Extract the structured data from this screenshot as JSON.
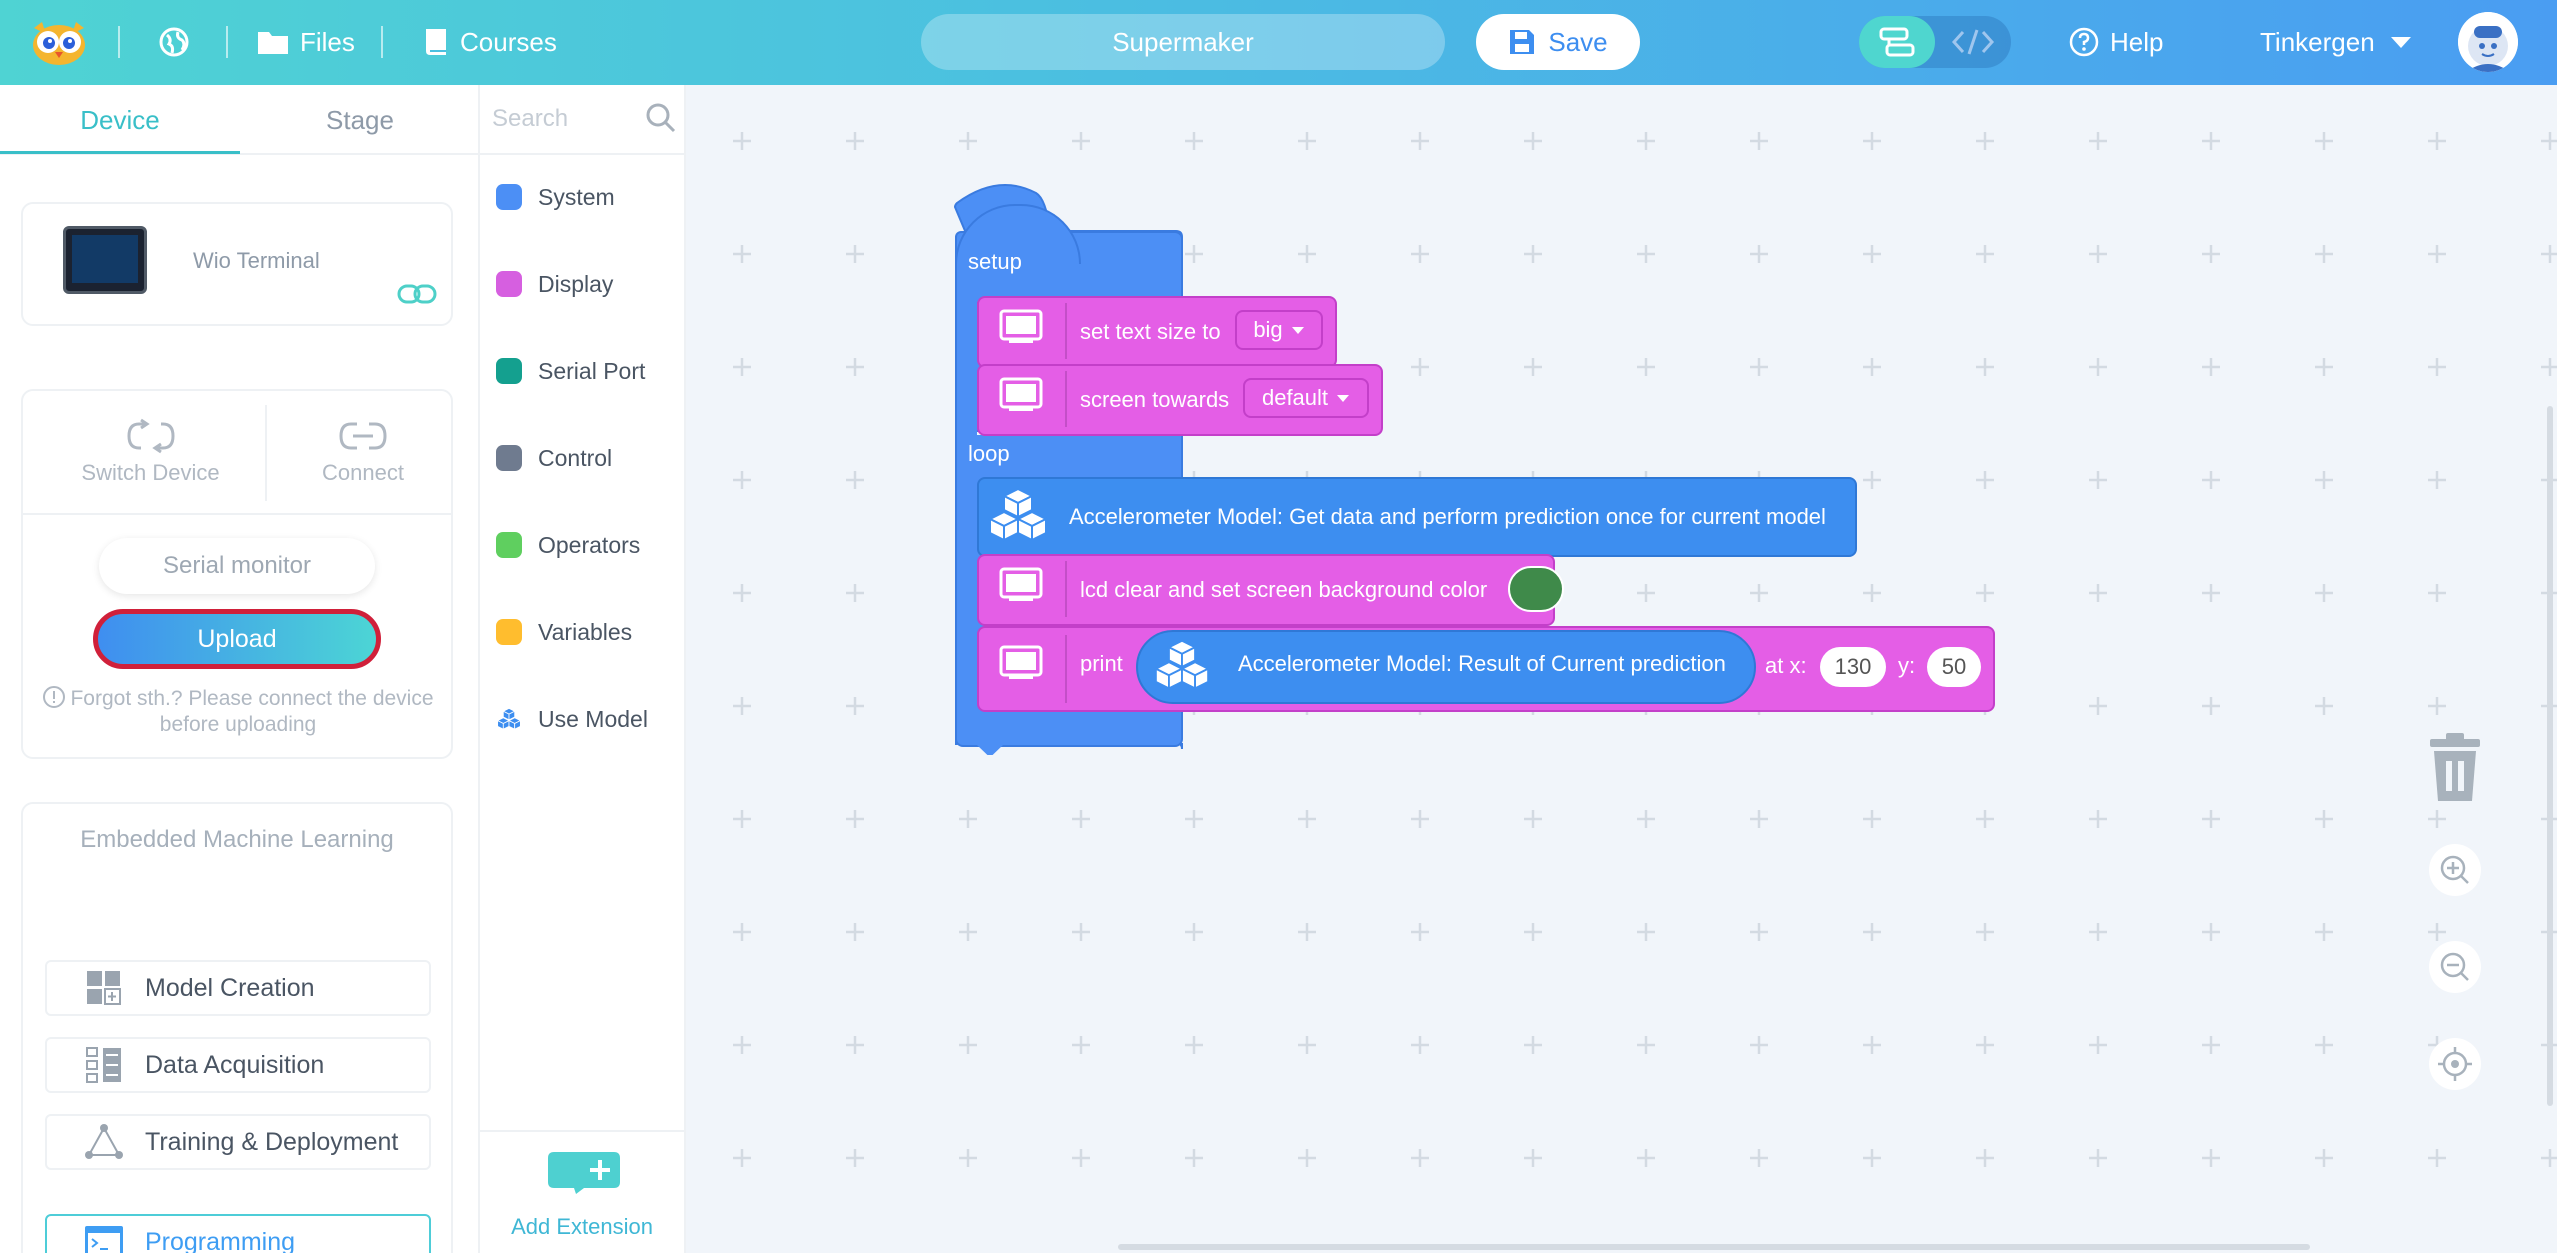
{
  "topbar": {
    "files": "Files",
    "courses": "Courses",
    "project_name": "Supermaker",
    "save": "Save",
    "help": "Help",
    "user": "Tinkergen"
  },
  "left_panel": {
    "tabs": [
      "Device",
      "Stage"
    ],
    "device_name": "Wio Terminal",
    "switch_device": "Switch Device",
    "connect": "Connect",
    "serial_monitor": "Serial monitor",
    "upload": "Upload",
    "upload_hint": "Forgot sth.? Please connect the device before uploading",
    "eml_title": "Embedded Machine Learning",
    "eml_items": [
      "Model Creation",
      "Data Acquisition",
      "Training & Deployment",
      "Programming"
    ]
  },
  "categories": {
    "search_placeholder": "Search",
    "items": [
      {
        "label": "System",
        "color": "#4c8ff5"
      },
      {
        "label": "Display",
        "color": "#d65fe0"
      },
      {
        "label": "Serial Port",
        "color": "#14a08f"
      },
      {
        "label": "Control",
        "color": "#6f7b8f"
      },
      {
        "label": "Operators",
        "color": "#5fcf5f"
      },
      {
        "label": "Variables",
        "color": "#ffbd2e"
      },
      {
        "label": "Use Model",
        "color": "#3d8ef0"
      }
    ],
    "add_extension": "Add Extension"
  },
  "blocks": {
    "setup": "setup",
    "set_text_size": "set text size to",
    "text_size_value": "big",
    "screen_towards": "screen towards",
    "screen_towards_value": "default",
    "loop": "loop",
    "accel_predict": "Accelerometer Model: Get data and perform prediction once for current model",
    "lcd_clear": "lcd clear and set screen background color",
    "lcd_color": "#3f8a4a",
    "print": "print",
    "accel_result": "Accelerometer Model: Result of Current prediction",
    "at_x": "at x:",
    "x_value": "130",
    "y_label": "y:",
    "y_value": "50"
  },
  "colors": {
    "accent": "#39bfc8",
    "event_block": "#4c8ff5",
    "display_block": "#e45ee6",
    "upload_border": "#d0203a"
  }
}
